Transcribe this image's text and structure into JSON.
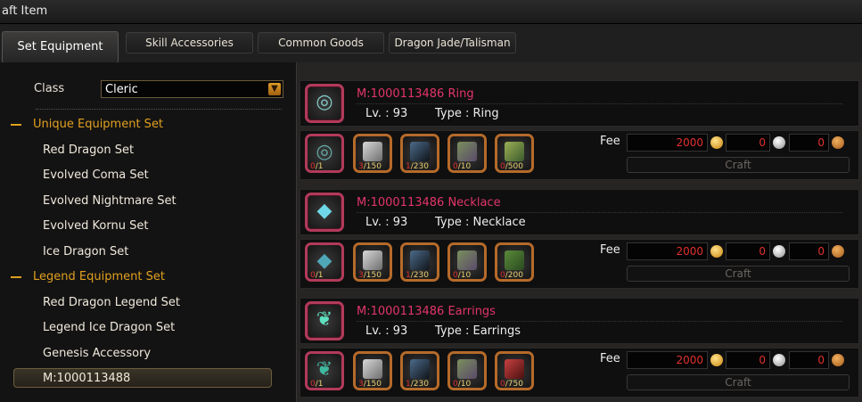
{
  "window": {
    "title": "aft Item"
  },
  "tabs": [
    {
      "label": "Set Equipment"
    },
    {
      "label": "Skill Accessories"
    },
    {
      "label": "Common Goods"
    },
    {
      "label": "Dragon Jade/Talisman"
    }
  ],
  "sidebar": {
    "class_label": "Class",
    "class_value": "Cleric",
    "groups": [
      {
        "label": "Unique Equipment Set"
      },
      {
        "label": "Legend Equipment Set"
      }
    ],
    "items": [
      "Red Dragon Set",
      "Evolved Coma Set",
      "Evolved Nightmare Set",
      "Evolved Kornu Set",
      "Ice Dragon Set",
      "Red Dragon Legend Set",
      "Legend Ice Dragon Set",
      "Genesis Accessory",
      "M:1000113488"
    ]
  },
  "recipes": [
    {
      "name": "M:1000113486 Ring",
      "level": "Lv. : 93",
      "type": "Type : Ring",
      "icon": "ring-icon",
      "materials": [
        {
          "have": "0",
          "req": "/1",
          "icon": "ring-icon"
        },
        {
          "have": "3",
          "req": "/150",
          "icon": "crystal-cube-icon"
        },
        {
          "have": "1",
          "req": "/230",
          "icon": "dark-cube-icon"
        },
        {
          "have": "0",
          "req": "/10",
          "icon": "prism-cube-icon"
        },
        {
          "have": "0",
          "req": "/500",
          "icon": "green-cube-icon"
        }
      ],
      "fee_label": "Fee",
      "fee_gold": "2000",
      "fee_silver": "0",
      "fee_copper": "0",
      "craft_label": "Craft"
    },
    {
      "name": "M:1000113486 Necklace",
      "level": "Lv. : 93",
      "type": "Type : Necklace",
      "icon": "necklace-icon",
      "materials": [
        {
          "have": "0",
          "req": "/1",
          "icon": "necklace-icon"
        },
        {
          "have": "3",
          "req": "/150",
          "icon": "crystal-cube-icon"
        },
        {
          "have": "1",
          "req": "/230",
          "icon": "dark-cube-icon"
        },
        {
          "have": "0",
          "req": "/10",
          "icon": "prism-cube-icon"
        },
        {
          "have": "0",
          "req": "/200",
          "icon": "green-cube-icon"
        }
      ],
      "fee_label": "Fee",
      "fee_gold": "2000",
      "fee_silver": "0",
      "fee_copper": "0",
      "craft_label": "Craft"
    },
    {
      "name": "M:1000113486 Earrings",
      "level": "Lv. : 93",
      "type": "Type : Earrings",
      "icon": "earrings-icon",
      "materials": [
        {
          "have": "0",
          "req": "/1",
          "icon": "earrings-icon"
        },
        {
          "have": "3",
          "req": "/150",
          "icon": "crystal-cube-icon"
        },
        {
          "have": "1",
          "req": "/230",
          "icon": "dark-cube-icon"
        },
        {
          "have": "0",
          "req": "/10",
          "icon": "prism-cube-icon"
        },
        {
          "have": "0",
          "req": "/750",
          "icon": "red-cube-icon"
        }
      ],
      "fee_label": "Fee",
      "fee_gold": "2000",
      "fee_silver": "0",
      "fee_copper": "0",
      "craft_label": "Craft"
    }
  ],
  "colors": {
    "accent": "#e0a020",
    "item_name": "#e2356a",
    "fee_value": "#e23030"
  }
}
